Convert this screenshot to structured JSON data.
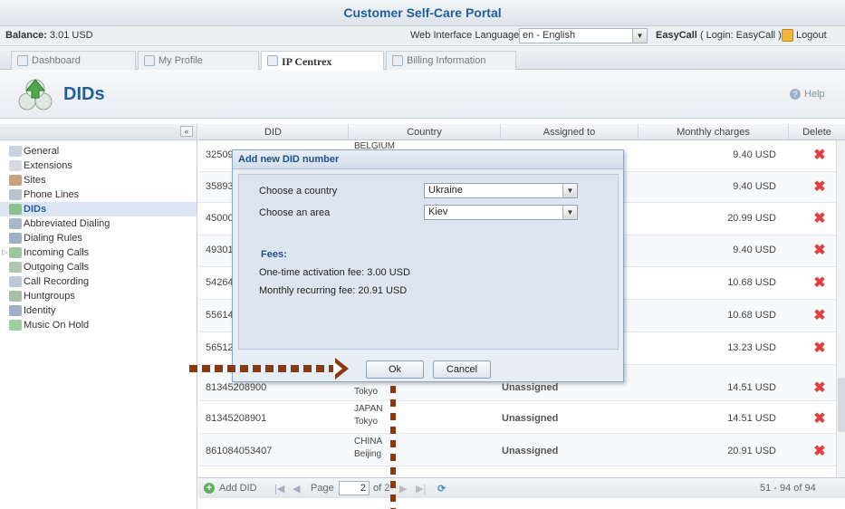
{
  "header": {
    "title": "Customer Self-Care Portal"
  },
  "topbar": {
    "balance_label": "Balance:",
    "balance_value": "3.01 USD",
    "lang_label": "Web Interface Language:",
    "lang_value": "en - English",
    "user_name": "EasyCall",
    "user_login": "( Login: EasyCall )",
    "logout": "Logout"
  },
  "tabs": [
    {
      "label": "Dashboard"
    },
    {
      "label": "My Profile"
    },
    {
      "label": "IP Centrex"
    },
    {
      "label": "Billing Information"
    }
  ],
  "page": {
    "title": "DIDs",
    "help": "Help"
  },
  "sidebar": {
    "items": [
      {
        "label": "General"
      },
      {
        "label": "Extensions"
      },
      {
        "label": "Sites"
      },
      {
        "label": "Phone Lines"
      },
      {
        "label": "DIDs"
      },
      {
        "label": "Abbreviated Dialing"
      },
      {
        "label": "Dialing Rules"
      },
      {
        "label": "Incoming Calls"
      },
      {
        "label": "Outgoing Calls"
      },
      {
        "label": "Call Recording"
      },
      {
        "label": "Huntgroups"
      },
      {
        "label": "Identity"
      },
      {
        "label": "Music On Hold"
      }
    ]
  },
  "grid": {
    "columns": [
      "DID",
      "Country",
      "Assigned to",
      "Monthly charges",
      "Delete"
    ],
    "rows": [
      {
        "did": "32509",
        "country": "BELGIUM",
        "city": "",
        "assigned": "",
        "charge": "9.40 USD"
      },
      {
        "did": "35893",
        "country": "",
        "city": "",
        "assigned": "",
        "charge": "9.40 USD"
      },
      {
        "did": "45000",
        "country": "",
        "city": "",
        "assigned": "",
        "charge": "20.99 USD"
      },
      {
        "did": "49301",
        "country": "",
        "city": "",
        "assigned": "",
        "charge": "9.40 USD"
      },
      {
        "did": "54264",
        "country": "",
        "city": "",
        "assigned": "",
        "charge": "10.68 USD"
      },
      {
        "did": "55614",
        "country": "",
        "city": "",
        "assigned": "",
        "charge": "10.68 USD"
      },
      {
        "did": "56512",
        "country": "",
        "city": "",
        "assigned": "",
        "charge": "13.23 USD"
      },
      {
        "did": "81345208900",
        "country": "",
        "city": "Tokyo",
        "assigned": "Unassigned",
        "charge": "14.51 USD"
      },
      {
        "did": "81345208901",
        "country": "JAPAN",
        "city": "Tokyo",
        "assigned": "Unassigned",
        "charge": "14.51 USD"
      },
      {
        "did": "861084053407",
        "country": "CHINA",
        "city": "Beijing",
        "assigned": "Unassigned",
        "charge": "20.91 USD"
      }
    ],
    "pager": {
      "add": "Add DID",
      "page_label": "Page",
      "page_value": "2",
      "of_label": "of 2",
      "range": "51 - 94 of 94"
    }
  },
  "dialog": {
    "title": "Add new DID number",
    "country_label": "Choose a country",
    "country_value": "Ukraine",
    "area_label": "Choose an area",
    "area_value": "Kiev",
    "fees_title": "Fees:",
    "activation_fee": "One-time activation fee: 3.00 USD",
    "recurring_fee": "Monthly recurring fee: 20.91 USD",
    "ok": "Ok",
    "cancel": "Cancel"
  },
  "colors": {
    "brand": "#1f5f9f",
    "annotation": "#8b3a10",
    "delete": "#e04040"
  }
}
